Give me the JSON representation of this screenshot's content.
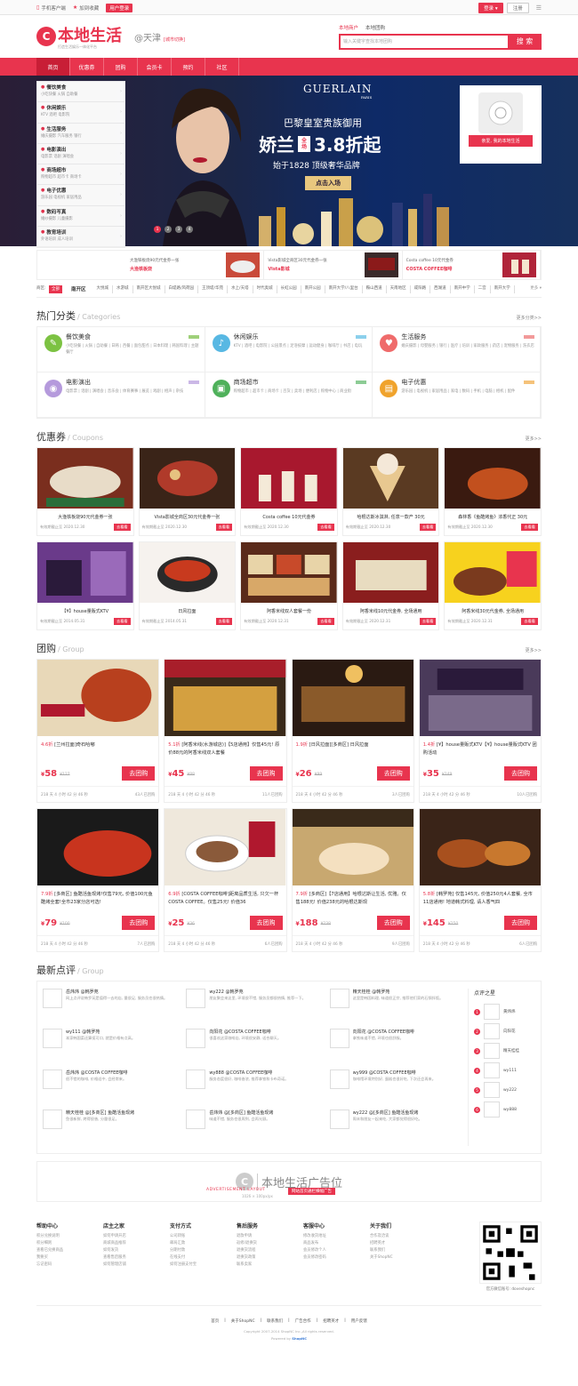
{
  "topbar": {
    "mobile": "手机客户端",
    "favorite": "加到收藏",
    "user_center": "用户登录",
    "login": "登录",
    "register": "注册"
  },
  "header": {
    "logo": "本地生活",
    "logo_sub": "打造生活娱乐一体化平台",
    "city": "@天津",
    "city_switch": "[城市切换]",
    "search_tabs": [
      "本地商户",
      "本地团购"
    ],
    "search_placeholder": "输入关键字查找本地团购",
    "search_button": "搜 索"
  },
  "nav": [
    "首页",
    "优惠券",
    "团购",
    "会员卡",
    "预约",
    "社区"
  ],
  "categories": [
    {
      "title": "餐饮美食",
      "sub": "小吃快餐  火锅  自助餐"
    },
    {
      "title": "休闲娱乐",
      "sub": "KTV  酒吧  电影院"
    },
    {
      "title": "生活服务",
      "sub": "婚庆摄影  汽车服务  银行"
    },
    {
      "title": "电影演出",
      "sub": "电影票  话剧  演唱会"
    },
    {
      "title": "商场超市",
      "sub": "购物超市  超市卡  商场卡"
    },
    {
      "title": "电子优惠",
      "sub": "游乐园  电视机  家居用品"
    },
    {
      "title": "数码写真",
      "sub": "婚纱摄影  儿童摄影"
    },
    {
      "title": "教育培训",
      "sub": "外语培训  成人培训"
    }
  ],
  "banner": {
    "brand": "GUERLAIN",
    "brand_sub": "PARIS",
    "line1": "巴黎皇室贵族御用",
    "line2a": "娇兰",
    "tag": "全场",
    "line2b": "3.8折起",
    "line3": "始于1828 顶级奢华品牌",
    "cta": "点击入场",
    "dots": [
      "1",
      "2",
      "3",
      "4"
    ],
    "qr_button": "亲爱, 我的本地生活"
  },
  "promos": [
    {
      "text": "大渔铁板烧90元代金券一张",
      "shop": "大渔铁板烧"
    },
    {
      "text": "Vista影城全商区30元代金券一张",
      "shop": "Vista影城"
    },
    {
      "text": "Costa coffee 10元代金券",
      "shop": "COSTA COFFEE咖啡"
    }
  ],
  "areas": {
    "label": "商区:",
    "all": "全部",
    "district": "南开区",
    "list": [
      "大悦城",
      "水游城",
      "南开区大悦城",
      "白堤路/风荷园",
      "王顶堤/华苑",
      "水上/天塔",
      "时代奥城",
      "长虹公园",
      "南开公园",
      "南开大学/八里台",
      "鞍山西道",
      "天南地区",
      "咸阳路",
      "西湖道",
      "南开中学",
      "二宫",
      "南开大学"
    ],
    "more": "更多"
  },
  "hot": {
    "title": "热门分类",
    "en": "Categories",
    "more": "更多分类>>",
    "items": [
      {
        "name": "餐饮美食",
        "color": "#7cc242",
        "sub": "小吃快餐 | 火锅 | 自助餐 | 日韩 | 西餐 | 面包甜点 | 日本料理 | 韩国料理 | 主题餐厅"
      },
      {
        "name": "休闲娱乐",
        "color": "#58b8e3",
        "sub": "KTV | 酒吧 | 电影院 | 公园景点 | 足浴按摩 | 运动健身 | 咖啡厅 | 书店 | 电玩"
      },
      {
        "name": "生活服务",
        "color": "#ef6b6b",
        "sub": "婚庆摄影 | 母婴服务 | 银行 | 医疗 | 培训 | 家政服务 | 药店 | 宠物服务 | 洗衣店"
      },
      {
        "name": "电影演出",
        "color": "#b59adc",
        "sub": "电影票 | 话剧 | 演唱会 | 音乐会 | 体育赛事 | 展览 | 戏剧 | 相声 | 杂技"
      },
      {
        "name": "商场超市",
        "color": "#4fb15b",
        "sub": "购物超市 | 超市卡 | 商场卡 | 百货 | 卖场 | 便利店 | 购物中心 | 商业街"
      },
      {
        "name": "电子优惠",
        "color": "#f0a32c",
        "sub": "游乐园 | 电视机 | 家居用品 | 家电 | 数码 | 手机 | 电脑 | 相机 | 配件"
      }
    ]
  },
  "coupons": {
    "title": "优惠券",
    "en": "Coupons",
    "more": "更多>>",
    "items": [
      {
        "title": "大渔铁板烧90元代金券一张",
        "date": "有效期截止至 2020.12.30",
        "btn": "去看看"
      },
      {
        "title": "Vista影城全商区30元代金券一张",
        "date": "有效期截止至 2020.12.30",
        "btn": "去看看"
      },
      {
        "title": "Costa coffee 10元代金券",
        "date": "有效期截止至 2020.12.30",
        "btn": "去看看"
      },
      {
        "title": "哈根达斯冰淇淋, 任意一款产 30元",
        "date": "有效期截止至 2020.12.30",
        "btn": "去看看"
      },
      {
        "title": "森林香《鱼酷烤鱼》浓香代正 30元",
        "date": "有效期截止至 2020.12.30",
        "btn": "去看看"
      },
      {
        "title": "【¥】house量贩式KTV",
        "date": "有效期截止至 2014.05.31",
        "btn": "去看看"
      },
      {
        "title": "日风拉面",
        "date": "有效期截止至 2014.05.31",
        "btn": "去看看"
      },
      {
        "title": "阿香米线双人套餐一份",
        "date": "有效期截止至 2020.12.31",
        "btn": "去看看"
      },
      {
        "title": "阿香米线10元代金券, 全场通用",
        "date": "有效期截止至 2020.12.31",
        "btn": "去看看"
      },
      {
        "title": "阿香米线30元代金券, 全场通用",
        "date": "有效期截止至 2020.12.31",
        "btn": "去看看"
      }
    ]
  },
  "group": {
    "title": "团购",
    "en": "Group",
    "more": "更多>>",
    "items": [
      {
        "rate": "4.6折",
        "title": "[兰州拉面]奇石哈嘟",
        "price": "58",
        "orig": "¥127",
        "btn": "去团购",
        "time": "218 天 4 小时 42 分 46 秒",
        "sold": "43人已团购"
      },
      {
        "rate": "5.1折",
        "title": "[阿香米线(水游城店)]【5店通用】仅售45元! 原价88元的阿香米线双人套餐",
        "price": "45",
        "orig": "¥88",
        "btn": "去团购",
        "time": "218 天 4 小时 42 分 46 秒",
        "sold": "11人已团购"
      },
      {
        "rate": "1.9折",
        "title": "[日风拉面][多商区] 日风拉面",
        "price": "26",
        "orig": "¥99",
        "btn": "去团购",
        "time": "218 天 4 小时 42 分 46 秒",
        "sold": "3人已团购"
      },
      {
        "rate": "1.4折",
        "title": "[¥】house量贩式KTV【¥】house量贩式KTV 团购活动",
        "price": "35",
        "orig": "¥249",
        "btn": "去团购",
        "time": "218 天 4 小时 42 分 46 秒",
        "sold": "10人已团购"
      },
      {
        "rate": "7.9折",
        "title": "[多商区] 鱼酷活鱼现烤!仅售79元, 价值100元鱼酷烤全套!全市23家分店可选!",
        "price": "79",
        "orig": "¥100",
        "btn": "去团购",
        "time": "218 天 4 小时 42 分 46 秒",
        "sold": "7人已团购"
      },
      {
        "rate": "6.9折",
        "title": "[COSTA COFFEE咖啡]距离品质生活, 只欠一杯COSTA COFFEE。仅售25元! 价值36",
        "price": "25",
        "orig": "¥36",
        "btn": "去团购",
        "time": "218 天 4 小时 42 分 46 秒",
        "sold": "6人已团购"
      },
      {
        "rate": "7.9折",
        "title": "[多商区]【7店通用】哈根达斯让生活, 优雅。仅售188元! 价值238元的哈根达斯现",
        "price": "188",
        "orig": "¥238",
        "btn": "去团购",
        "time": "218 天 4 小时 42 分 46 秒",
        "sold": "9人已团购"
      },
      {
        "rate": "5.8折",
        "title": "[韩罗苑] 仅售145元, 价值250元4人套餐, 全市11店通用! 地道韩式料理, 请人香气四",
        "price": "145",
        "orig": "¥250",
        "btn": "去团购",
        "time": "218 天 4 小时 42 分 46 秒",
        "sold": "6人已团购"
      }
    ]
  },
  "reviews": {
    "title": "最新点评",
    "en": "Group",
    "items": [
      {
        "user": "岳炜炜",
        "shop": "@韩罗苑",
        "text": "网上点评说韩罗苑是值得一去的店, 量很足, 服务员也很热情。"
      },
      {
        "user": "wy222",
        "shop": "@韩罗苑",
        "text": "朋友聚会来这里, 环境很不错, 服务员都很热情, 推荐一下。"
      },
      {
        "user": "精天桂桂",
        "shop": "@韩罗苑",
        "text": "这里是韩国料理, 味道很正宗, 推荐他们家的石锅拌饭。"
      },
      {
        "user": "wy111",
        "shop": "@韩罗苑",
        "text": "本家韩国菜还算挺可口, 就是价格有点高。"
      },
      {
        "user": "向阳花",
        "shop": "@COSTA COFFEE咖啡",
        "text": "很喜欢这家咖啡店, 环境很安静, 适合聊天。"
      },
      {
        "user": "向阳花",
        "shop": "@COSTA COFFEE咖啡",
        "text": "拿铁味道不错, 环境也很舒服。"
      },
      {
        "user": "岳炜炜",
        "shop": "@COSTA COFFEE咖啡",
        "text": "很不错的咖啡, 价格适中, 会经常来。"
      },
      {
        "user": "wy888",
        "shop": "@COSTA COFFEE咖啡",
        "text": "服务态度很好, 咖啡香浓, 推荐拿铁和卡布奇诺。"
      },
      {
        "user": "wy999",
        "shop": "@COSTA COFFEE咖啡",
        "text": "咖啡馆环境特别好, 蛋糕也很好吃, 下次还会再来。"
      },
      {
        "user": "精天桂桂",
        "shop": "@[多商区] 鱼酷活鱼现烤",
        "text": "鱼很新鲜, 烤得很香, 分量很足。"
      },
      {
        "user": "岳炜炜",
        "shop": "@[多商区] 鱼酷活鱼现烤",
        "text": "味道不错, 服务也很周到, 会再光顾。"
      },
      {
        "user": "wy222",
        "shop": "@[多商区] 鱼酷活鱼现烤",
        "text": "周末和朋友一起来吃, 大家都觉得很好吃。"
      }
    ],
    "stars_title": "点评之星",
    "stars": [
      {
        "n": "1",
        "name": "黄炜炜"
      },
      {
        "n": "2",
        "name": "向阳花"
      },
      {
        "n": "3",
        "name": "精天桂桂"
      },
      {
        "n": "4",
        "name": "wy111"
      },
      {
        "n": "5",
        "name": "wy222"
      },
      {
        "n": "6",
        "name": "wy888"
      }
    ]
  },
  "ad": {
    "text": "本地生活广告位",
    "label": "ADVERTISEMENT LAYOUT",
    "size": "1026 × 100px/px",
    "btn": "网站首页通栏横幅广告"
  },
  "footer": {
    "cols": [
      {
        "title": "帮助中心",
        "items": [
          "积分兑换说明",
          "积分细则",
          "查看已兑换商品",
          "我要买",
          "忘记密码"
        ]
      },
      {
        "title": "店主之家",
        "items": [
          "如何申请开店",
          "商城商品推荐",
          "如何发货",
          "查看售后服务",
          "如何管理店铺"
        ]
      },
      {
        "title": "支付方式",
        "items": [
          "公司转账",
          "邮局汇款",
          "分期付款",
          "在线支付",
          "如何注册支付宝"
        ]
      },
      {
        "title": "售后服务",
        "items": [
          "退款申请",
          "返修/退换货",
          "退换货流程",
          "退换货政策",
          "联系卖家"
        ]
      },
      {
        "title": "客服中心",
        "items": [
          "修改收货地址",
          "商品发布",
          "会员修改个人",
          "会员修改密码"
        ]
      },
      {
        "title": "关于我们",
        "items": [
          "合作及洽谈",
          "招聘英才",
          "联系我们",
          "关于ShopNC"
        ]
      }
    ],
    "qr_text": "官方微信账号: doveshopnc",
    "links": [
      "首页",
      "关于ShopNC",
      "联系我们",
      "广告合作",
      "招聘英才",
      "用户反馈"
    ],
    "copyright": "Copyright 2007-2014 ShopNC Inc.,All rights reserved.",
    "powered_by": "Powered by",
    "powered_brand": "ShopNC"
  }
}
